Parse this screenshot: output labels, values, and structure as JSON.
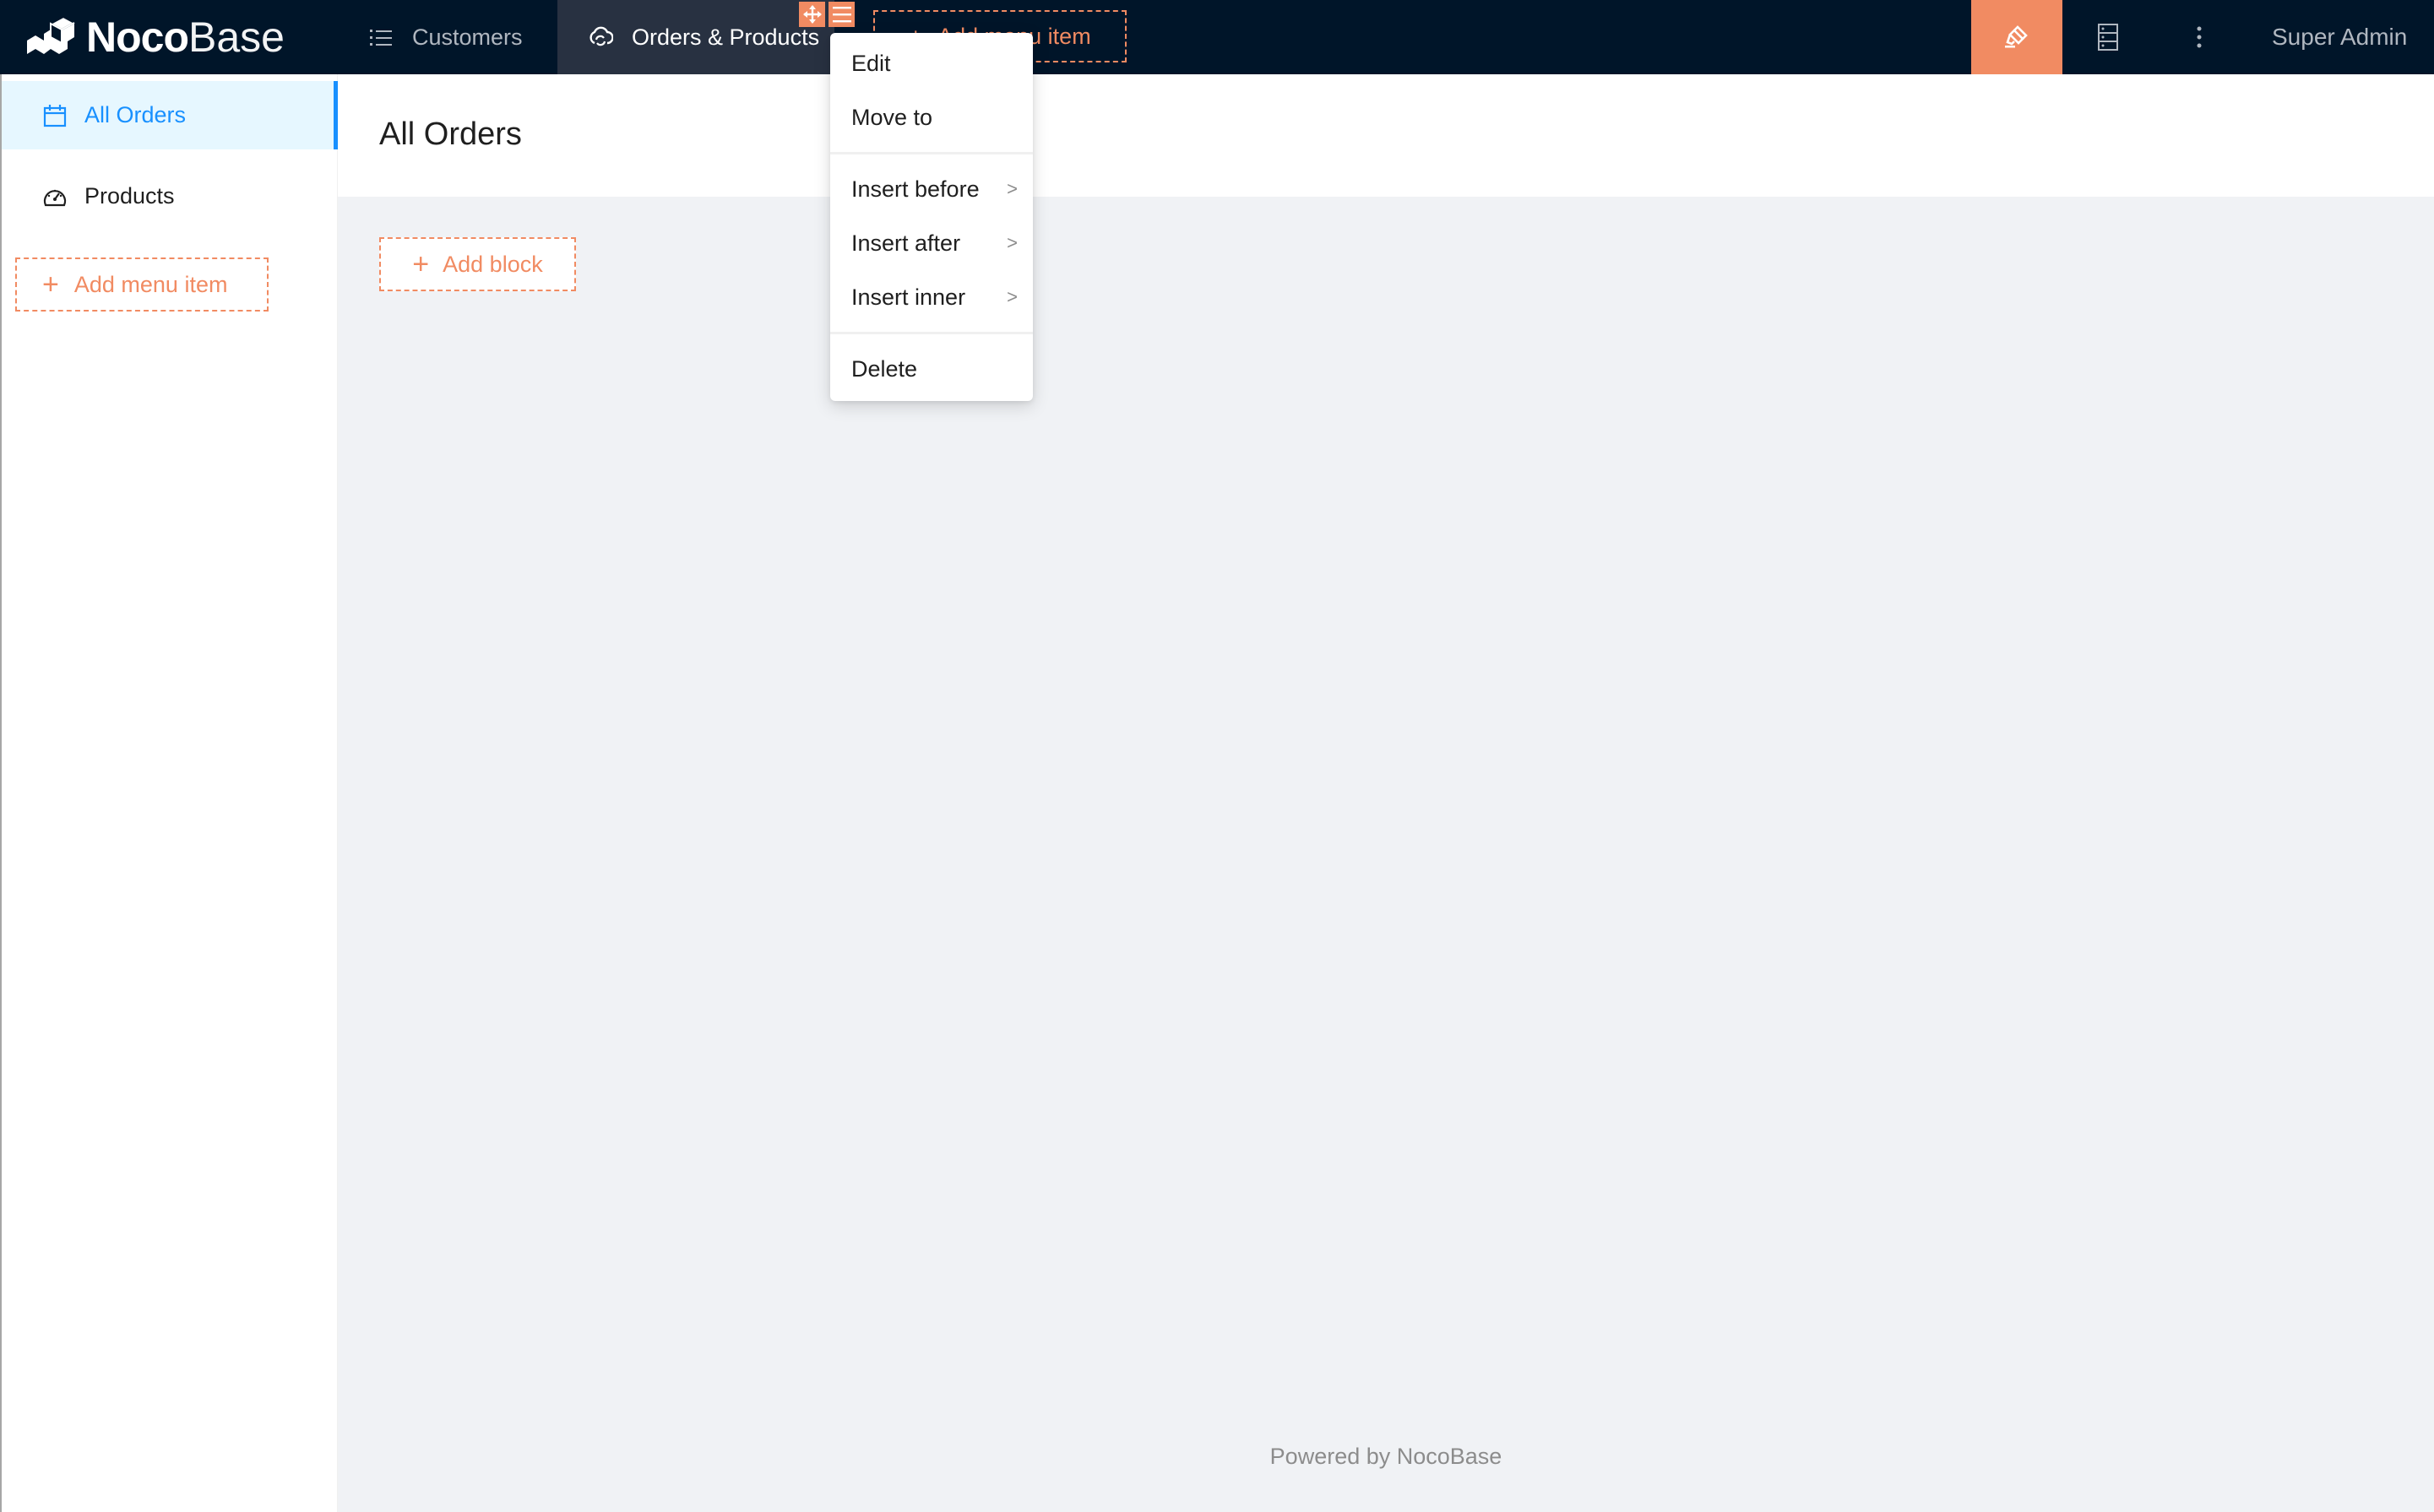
{
  "header": {
    "logo": {
      "bold": "Noco",
      "light": "Base"
    },
    "nav": [
      {
        "label": "Customers",
        "icon": "unordered-list-icon",
        "active": false
      },
      {
        "label": "Orders & Products",
        "icon": "cloud-sync-icon",
        "active": true
      }
    ],
    "add_menu_item_label": "Add menu item",
    "user_name": "Super Admin",
    "accent_color": "#f18b62",
    "bg_color": "#001529"
  },
  "sidebar": {
    "items": [
      {
        "label": "All Orders",
        "icon": "calendar-icon",
        "active": true
      },
      {
        "label": "Products",
        "icon": "dashboard-icon",
        "active": false
      }
    ],
    "add_menu_item_label": "Add menu item",
    "active_color": "#1890ff"
  },
  "page": {
    "title": "All Orders",
    "add_block_label": "Add block",
    "footer": "Powered by NocoBase"
  },
  "context_menu": {
    "items": [
      {
        "label": "Edit"
      },
      {
        "label": "Move to"
      },
      {
        "label": "Insert before",
        "submenu": true
      },
      {
        "label": "Insert after",
        "submenu": true
      },
      {
        "label": "Insert inner",
        "submenu": true
      },
      {
        "label": "Delete"
      }
    ]
  }
}
